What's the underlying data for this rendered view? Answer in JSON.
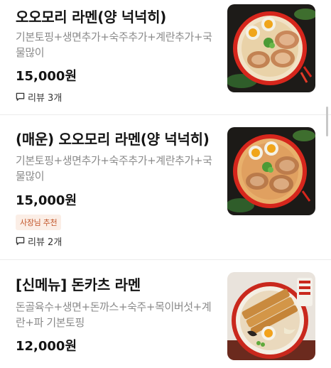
{
  "menu": {
    "items": [
      {
        "name": "오오모리 라멘(양 넉넉히)",
        "description": "기본토핑+생면추가+숙주추가+계란추가+국물많이",
        "price": "15,000원",
        "review": "리뷰 3개",
        "image_icon": "ramen-chashu-photo"
      },
      {
        "name": "(매운) 오오모리 라멘(양 넉넉히)",
        "description": "기본토핑+생면추가+숙주추가+계란추가+국물많이",
        "price": "15,000원",
        "badge": "사장님 추천",
        "review": "리뷰 2개",
        "image_icon": "spicy-ramen-chashu-photo"
      },
      {
        "name": "[신메뉴] 돈카츠 라멘",
        "description": "돈골육수+생면+돈까스+숙주+목이버섯+계란+파 기본토핑",
        "price": "12,000원",
        "image_icon": "tonkatsu-ramen-photo"
      }
    ]
  },
  "colors": {
    "badge_bg": "#fbeee6",
    "badge_text": "#c2562a",
    "description": "#8a8a8a"
  },
  "icons": {
    "review": "speech-bubble-icon"
  }
}
